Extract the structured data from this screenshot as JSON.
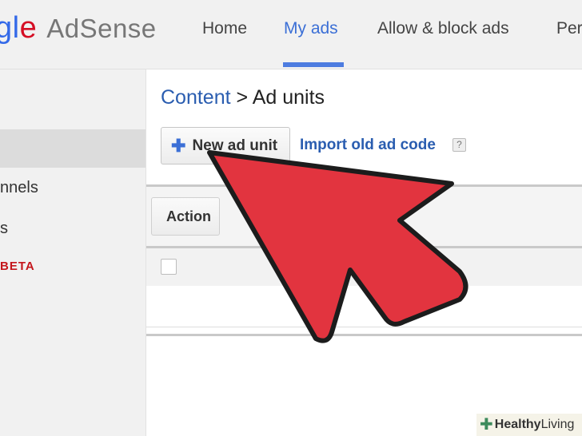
{
  "header": {
    "logo": {
      "part1": "gl",
      "part2": "e",
      "product": "AdSense"
    },
    "tabs": [
      {
        "label": "Home"
      },
      {
        "label": "My ads",
        "active": true
      },
      {
        "label": "Allow & block ads"
      },
      {
        "label": "Per"
      }
    ]
  },
  "sidebar": {
    "items": [
      {
        "label": "nnels"
      },
      {
        "label": "s"
      }
    ],
    "beta_label": "BETA"
  },
  "breadcrumb": {
    "parent": "Content",
    "separator": ">",
    "current": "Ad units"
  },
  "toolbar": {
    "new_button_label": "New ad unit",
    "new_button_icon": "plus-icon",
    "import_link": "Import old ad code",
    "help_icon_text": "?"
  },
  "table": {
    "action_label": "Action"
  },
  "watermark": {
    "bold": "Healthy",
    "rest": " Living"
  },
  "colors": {
    "link": "#2a5db0",
    "tab_active": "#3b6fd6",
    "arrow_fill": "#e2343f",
    "beta": "#c4161c"
  }
}
